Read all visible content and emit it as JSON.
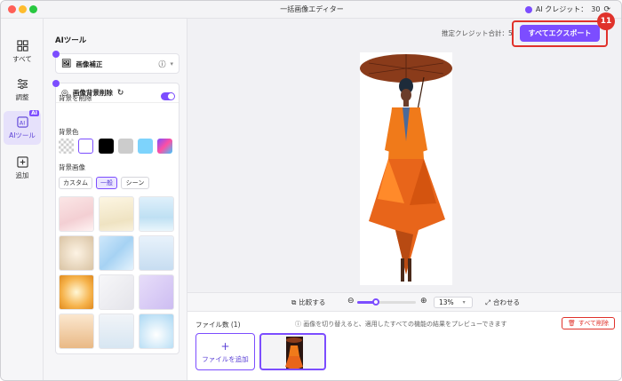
{
  "window": {
    "title": "一括画像エディター"
  },
  "credits": {
    "label": "AI クレジット：",
    "value": "30"
  },
  "rail": {
    "items": [
      {
        "label": "すべて"
      },
      {
        "label": "調整"
      },
      {
        "label": "AIツール",
        "badge": "AI"
      },
      {
        "label": "追加"
      }
    ]
  },
  "panel": {
    "title": "AIツール",
    "enhance": {
      "label": "画像補正"
    },
    "bg_remove": {
      "label": "画像背景削除",
      "remove_label": "背景を削除",
      "bg_color_label": "背景色",
      "bg_image_label": "背景画像",
      "swatch_colors": [
        "checker",
        "#ffffff",
        "#000000",
        "#cccccc",
        "#7dd3fc",
        "gradient"
      ],
      "tabs": [
        "カスタム",
        "一般",
        "シーン"
      ],
      "active_tab": "一般"
    }
  },
  "header": {
    "estimate_label": "推定クレジット合計：",
    "estimate_value": "5",
    "export_label": "すべてエクスポート",
    "step_number": "11"
  },
  "zoombar": {
    "compare_label": "比較する",
    "zoom_value": "13%",
    "zoom_fraction": 0.13,
    "fit_label": "合わせる"
  },
  "files": {
    "count_label": "ファイル数 (1)",
    "hint": "画像を切り替えると、適用したすべての機能の結果をプレビューできます",
    "delete_all_label": "すべて削除",
    "add_file_label": "ファイルを追加"
  },
  "colors": {
    "accent": "#7c4dff",
    "highlight": "#e0322b"
  }
}
